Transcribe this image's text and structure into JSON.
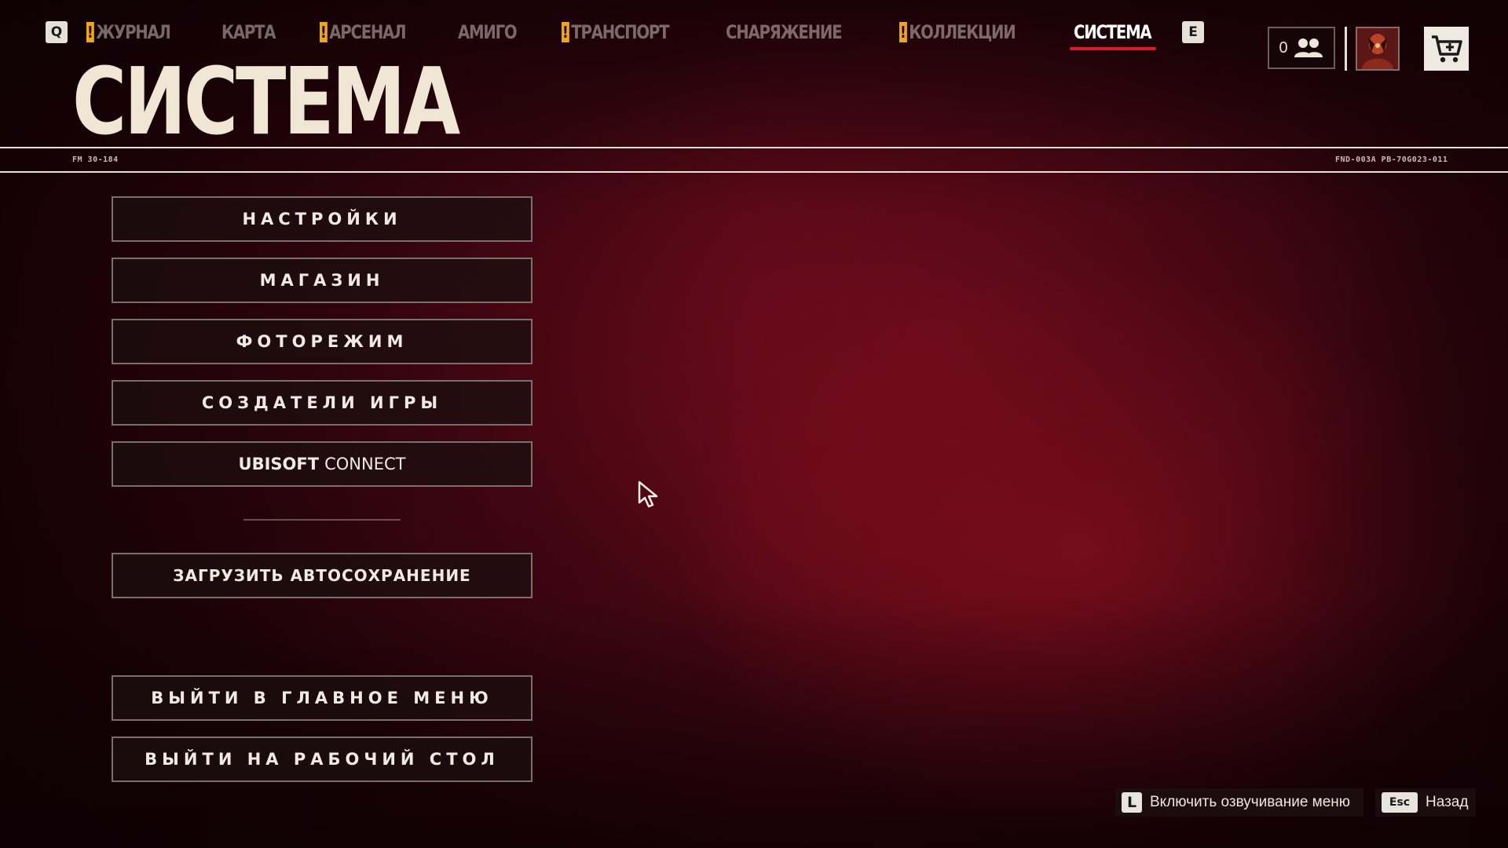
{
  "nav": {
    "prev_key": "Q",
    "next_key": "E",
    "tabs": [
      {
        "label": "ЖУРНАЛ",
        "alert": true,
        "active": false
      },
      {
        "label": "КАРТА",
        "alert": false,
        "active": false
      },
      {
        "label": "АРСЕНАЛ",
        "alert": true,
        "active": false
      },
      {
        "label": "АМИГО",
        "alert": false,
        "active": false
      },
      {
        "label": "ТРАНСПОРТ",
        "alert": true,
        "active": false
      },
      {
        "label": "СНАРЯЖЕНИЕ",
        "alert": false,
        "active": false
      },
      {
        "label": "КОЛЛЕКЦИИ",
        "alert": true,
        "active": false
      },
      {
        "label": "СИСТЕМА",
        "alert": false,
        "active": true
      }
    ],
    "alert_mark": "!"
  },
  "header": {
    "title": "СИСТЕМА",
    "code_left": "FM 30-184",
    "code_right": "FND-003A PB-70G023-011",
    "friends_count": "0"
  },
  "menu": {
    "settings": "НАСТРОЙКИ",
    "store": "МАГАЗИН",
    "photo_mode": "ФОТОРЕЖИМ",
    "credits": "СОЗДАТЕЛИ ИГРЫ",
    "ubisoft_connect_bold": "UBISOFT",
    "ubisoft_connect_regular": "CONNECT",
    "load_autosave": "ЗАГРУЗИТЬ АВТОСОХРАНЕНИЕ",
    "quit_main_menu": "ВЫЙТИ В ГЛАВНОЕ МЕНЮ",
    "quit_desktop": "ВЫЙТИ НА РАБОЧИЙ СТОЛ"
  },
  "hints": {
    "narration_key": "L",
    "narration_label": "Включить озвучивание меню",
    "back_key": "Esc",
    "back_label": "Назад"
  },
  "colors": {
    "accent_underline": "#d81b2a",
    "alert": "#f0a51e",
    "background": "#3a0610",
    "title": "#efe6d4"
  }
}
